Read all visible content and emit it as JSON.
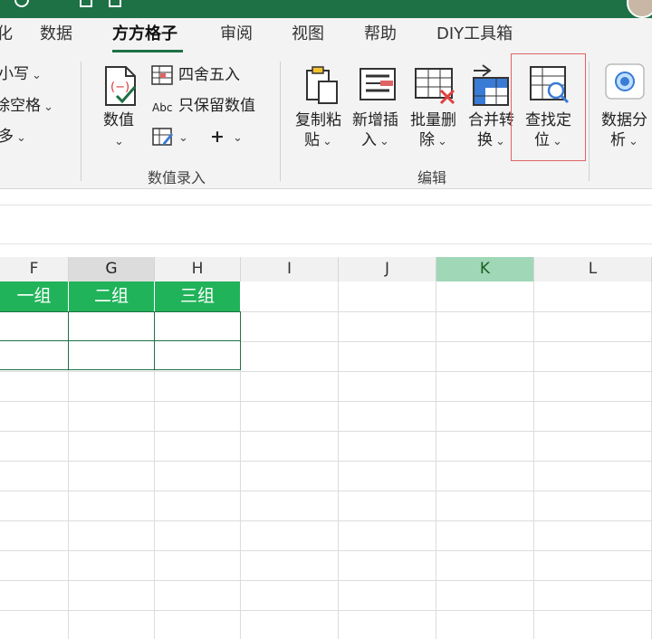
{
  "menu": {
    "tabs": [
      "化",
      "数据",
      "方方格子",
      "审阅",
      "视图",
      "帮助",
      "DIY工具箱"
    ],
    "active_tab": "方方格子"
  },
  "ribbon": {
    "left_partial": [
      "小写",
      "除空格",
      "多"
    ],
    "value_entry": {
      "big_button": "数值",
      "round": "四舍五入",
      "keep_values": "只保留数值",
      "abc_label": "Abc",
      "plus": "+",
      "group_label": "数值录入"
    },
    "edit": {
      "copy_paste": [
        "复制粘",
        "贴"
      ],
      "add_insert": [
        "新增插",
        "入"
      ],
      "batch_delete": [
        "批量删",
        "除"
      ],
      "merge_convert": [
        "合并转",
        "换"
      ],
      "find_locate": [
        "查找定",
        "位"
      ],
      "group_label": "编辑"
    },
    "analysis": [
      "数据分",
      "析"
    ]
  },
  "sheet": {
    "columns": [
      "F",
      "G",
      "H",
      "I",
      "J",
      "K",
      "L"
    ],
    "selected_columns": [
      "G",
      "K"
    ],
    "header_row": [
      "一组",
      "二组",
      "三组"
    ]
  },
  "colors": {
    "accent": "#1e7145",
    "header_fill": "#21b35a",
    "selected_col_k": "#9fd7b7",
    "highlight_border": "#e06464"
  }
}
